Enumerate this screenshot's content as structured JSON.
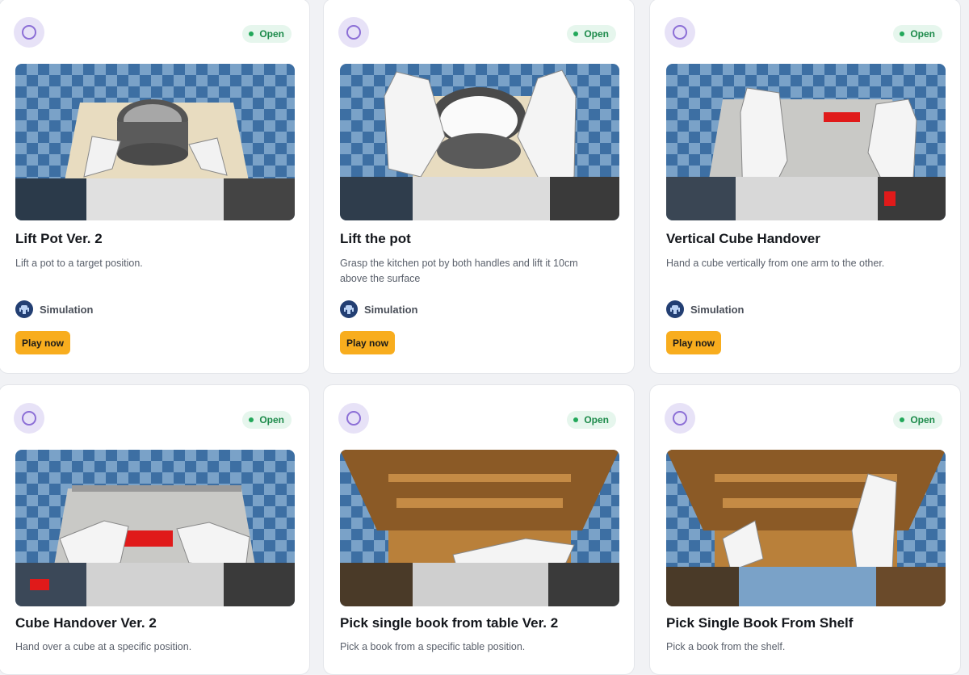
{
  "cards": [
    {
      "title": "Lift Pot Ver. 2",
      "description": "Lift a pot to a target position.",
      "status": "Open",
      "platform": "Simulation",
      "cta": "Play now",
      "scene": "pot-table"
    },
    {
      "title": "Lift the pot",
      "description": "Grasp the kitchen pot by both handles and lift it 10cm above the surface",
      "status": "Open",
      "platform": "Simulation",
      "cta": "Play now",
      "scene": "pot-arms"
    },
    {
      "title": "Vertical Cube Handover",
      "description": "Hand a cube vertically from one arm to the other.",
      "status": "Open",
      "platform": "Simulation",
      "cta": "Play now",
      "scene": "cube-vertical"
    },
    {
      "title": "Cube Handover Ver. 2",
      "description": "Hand over a cube at a specific position.",
      "status": "Open",
      "scene": "cube-handover"
    },
    {
      "title": "Pick single book from table Ver. 2",
      "description": "Pick a book from a specific table position.",
      "status": "Open",
      "scene": "book-table"
    },
    {
      "title": "Pick Single Book From Shelf",
      "description": "Pick a book from the shelf.",
      "status": "Open",
      "scene": "book-shelf"
    }
  ],
  "icons": {
    "avatar": "circle-outline-icon",
    "status": "status-dot-icon",
    "platform": "robot-icon"
  },
  "colors": {
    "accent": "#f8ad1e",
    "status_open": "#22a85a",
    "avatar_bg": "#e7e2f7",
    "floor_dark": "#3d6fa3",
    "floor_light": "#7aa2c8"
  }
}
